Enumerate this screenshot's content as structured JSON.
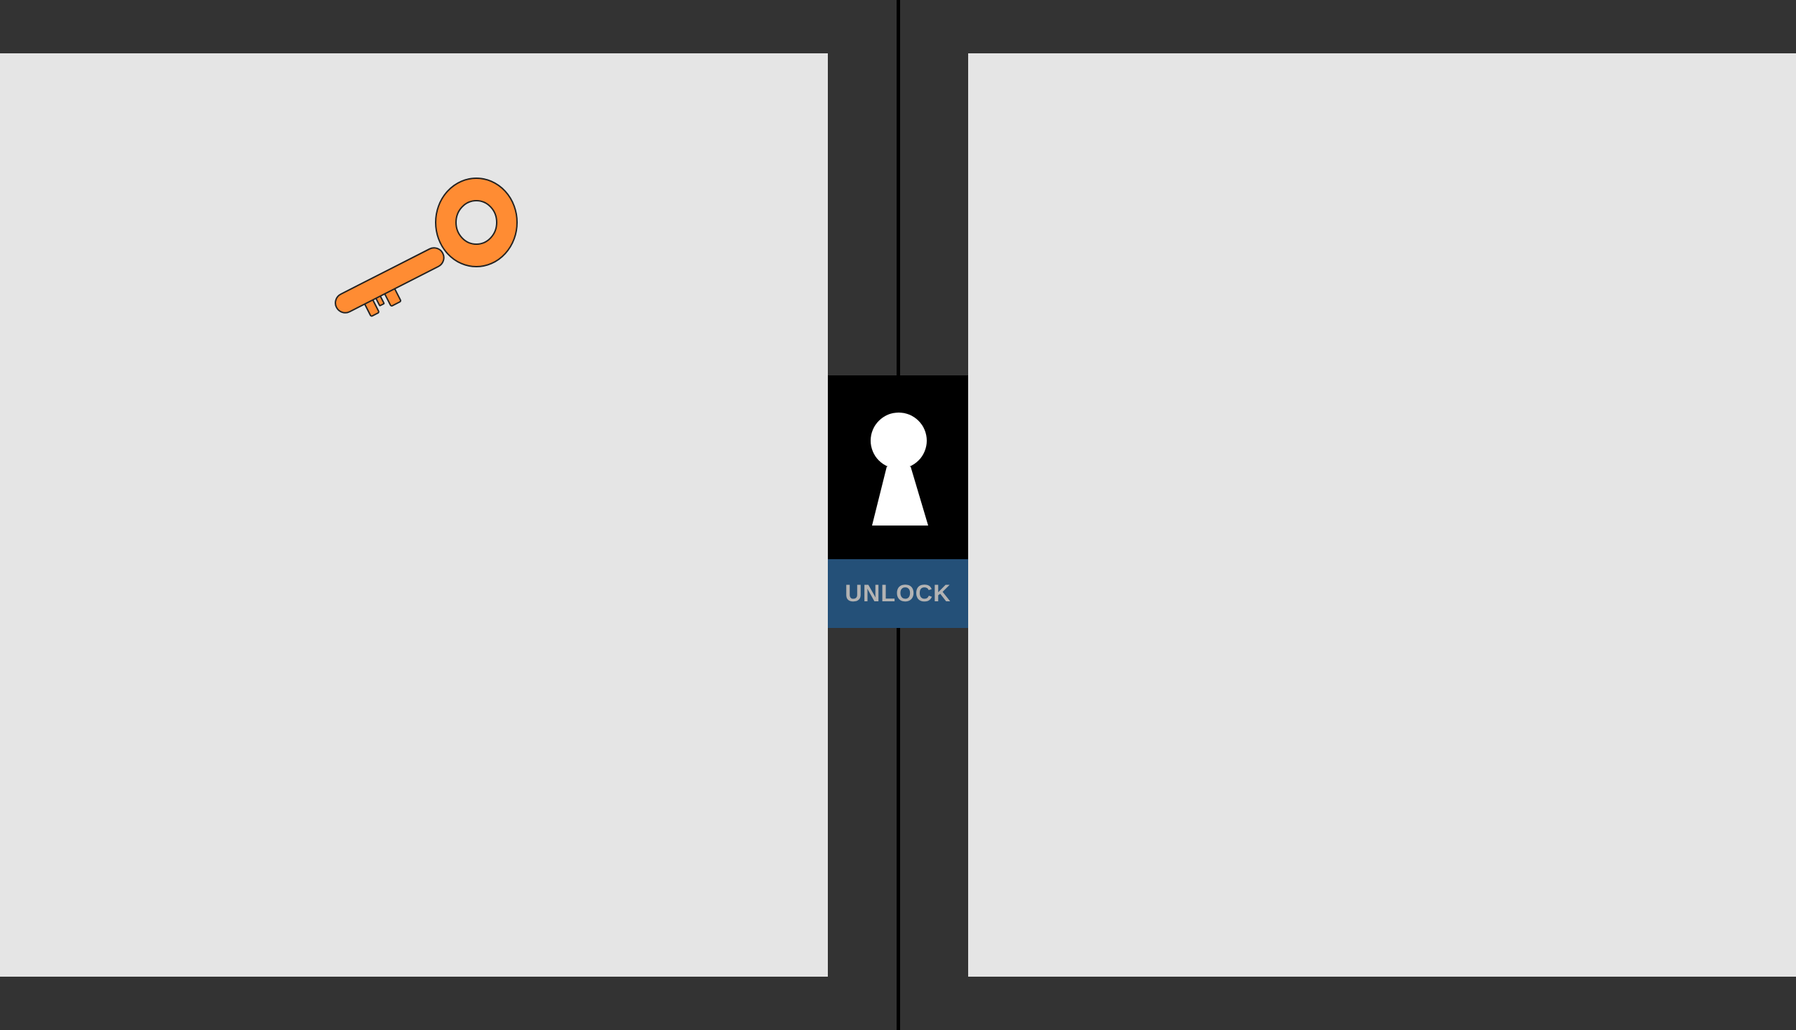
{
  "game": {
    "unlock_label": "UNLOCK"
  },
  "icons": {
    "key": "key-icon",
    "keyhole": "keyhole-icon"
  },
  "colors": {
    "wall": "#333333",
    "floor": "#e5e5e5",
    "key": "#ff8c33",
    "lock_plate": "#000000",
    "unlock_button": "#245078",
    "unlock_text": "#b3b3b3"
  }
}
